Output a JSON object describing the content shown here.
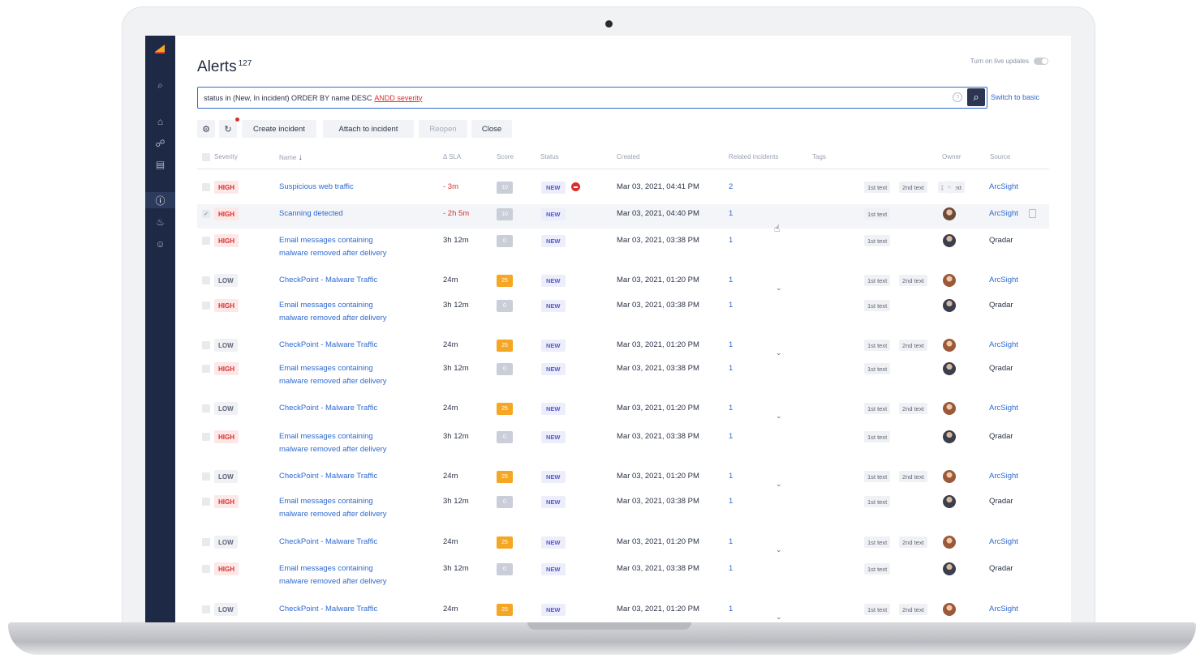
{
  "header": {
    "title": "Alerts",
    "count": "127",
    "live_label": "Turn on live updates"
  },
  "search": {
    "query_text": "status in (New, In incident) ORDER BY name DESC",
    "query_error": "ANDD severity",
    "help": "?",
    "switch_label": "Switch to basic"
  },
  "toolbar": {
    "create": "Create incident",
    "attach": "Attach to incident",
    "reopen": "Reopen",
    "close": "Close"
  },
  "columns": {
    "severity": "Severity",
    "name": "Name",
    "sla": "Δ SLA",
    "score": "Score",
    "status": "Status",
    "created": "Created",
    "related": "Related incidents",
    "tags": "Tags",
    "owner": "Owner",
    "source": "Source"
  },
  "sort_arrow": "↓",
  "colors": {
    "accent": "#2f6ad0",
    "danger": "#d92f2f",
    "sidebar": "#1e2a45",
    "score_high": "#f5a623",
    "score_low": "#c9ced8"
  },
  "icons": [
    "logo-icon",
    "search-icon",
    "home-icon",
    "users-icon",
    "document-icon",
    "alert-icon",
    "fire-icon",
    "chat-icon",
    "gear-icon",
    "refresh-icon",
    "stop-icon",
    "copy-icon",
    "chevron-down-icon",
    "hand-cursor-icon"
  ],
  "rows": [
    {
      "severity": "HIGH",
      "name_1": "Suspicious web traffic",
      "name_2": "",
      "sla": "- 3m",
      "score": "10",
      "status": "NEW",
      "created": "Mar 03, 2021, 04:41 PM",
      "related": "2",
      "tags": [
        "1st text",
        "2nd text",
        "3rd text"
      ],
      "source": "ArcSight"
    },
    {
      "severity": "HIGH",
      "name_1": "Scanning detected",
      "name_2": "",
      "sla": "- 2h 5m",
      "score": "10",
      "status": "NEW",
      "created": "Mar 03, 2021, 04:40 PM",
      "related": "1",
      "tags": [
        "1st text"
      ],
      "source": "ArcSight"
    },
    {
      "severity": "HIGH",
      "name_1": "Email messages containing",
      "name_2": "malware removed after delivery",
      "sla": "3h 12m",
      "score": "0",
      "status": "NEW",
      "created": "Mar 03, 2021, 03:38 PM",
      "related": "1",
      "tags": [
        "1st text"
      ],
      "source": "Qradar"
    },
    {
      "severity": "LOW",
      "name_1": "CheckPoint - Malware Traffic",
      "name_2": "",
      "sla": "24m",
      "score": "25",
      "status": "NEW",
      "created": "Mar 03, 2021, 01:20 PM",
      "related": "1",
      "tags": [
        "1st text",
        "2nd text"
      ],
      "source": "ArcSight"
    },
    {
      "severity": "HIGH",
      "name_1": "Email messages containing",
      "name_2": "malware removed after delivery",
      "sla": "3h 12m",
      "score": "0",
      "status": "NEW",
      "created": "Mar 03, 2021, 03:38 PM",
      "related": "1",
      "tags": [
        "1st text"
      ],
      "source": "Qradar"
    },
    {
      "severity": "LOW",
      "name_1": "CheckPoint - Malware Traffic",
      "name_2": "",
      "sla": "24m",
      "score": "25",
      "status": "NEW",
      "created": "Mar 03, 2021, 01:20 PM",
      "related": "1",
      "tags": [
        "1st text",
        "2nd text"
      ],
      "source": "ArcSight"
    },
    {
      "severity": "HIGH",
      "name_1": "Email messages containing",
      "name_2": "malware removed after delivery",
      "sla": "3h 12m",
      "score": "0",
      "status": "NEW",
      "created": "Mar 03, 2021, 03:38 PM",
      "related": "1",
      "tags": [
        "1st text"
      ],
      "source": "Qradar"
    },
    {
      "severity": "LOW",
      "name_1": "CheckPoint - Malware Traffic",
      "name_2": "",
      "sla": "24m",
      "score": "25",
      "status": "NEW",
      "created": "Mar 03, 2021, 01:20 PM",
      "related": "1",
      "tags": [
        "1st text",
        "2nd text"
      ],
      "source": "ArcSight"
    },
    {
      "severity": "HIGH",
      "name_1": "Email messages containing",
      "name_2": "malware removed after delivery",
      "sla": "3h 12m",
      "score": "0",
      "status": "NEW",
      "created": "Mar 03, 2021, 03:38 PM",
      "related": "1",
      "tags": [
        "1st text"
      ],
      "source": "Qradar"
    },
    {
      "severity": "LOW",
      "name_1": "CheckPoint - Malware Traffic",
      "name_2": "",
      "sla": "24m",
      "score": "25",
      "status": "NEW",
      "created": "Mar 03, 2021, 01:20 PM",
      "related": "1",
      "tags": [
        "1st text",
        "2nd text"
      ],
      "source": "ArcSight"
    },
    {
      "severity": "HIGH",
      "name_1": "Email messages containing",
      "name_2": "malware removed after delivery",
      "sla": "3h 12m",
      "score": "0",
      "status": "NEW",
      "created": "Mar 03, 2021, 03:38 PM",
      "related": "1",
      "tags": [
        "1st text"
      ],
      "source": "Qradar"
    },
    {
      "severity": "LOW",
      "name_1": "CheckPoint - Malware Traffic",
      "name_2": "",
      "sla": "24m",
      "score": "25",
      "status": "NEW",
      "created": "Mar 03, 2021, 01:20 PM",
      "related": "1",
      "tags": [
        "1st text",
        "2nd text"
      ],
      "source": "ArcSight"
    },
    {
      "severity": "HIGH",
      "name_1": "Email messages containing",
      "name_2": "malware removed after delivery",
      "sla": "3h 12m",
      "score": "0",
      "status": "NEW",
      "created": "Mar 03, 2021, 03:38 PM",
      "related": "1",
      "tags": [
        "1st text"
      ],
      "source": "Qradar"
    },
    {
      "severity": "LOW",
      "name_1": "CheckPoint - Malware Traffic",
      "name_2": "",
      "sla": "24m",
      "score": "25",
      "status": "NEW",
      "created": "Mar 03, 2021, 01:20 PM",
      "related": "1",
      "tags": [
        "1st text",
        "2nd text"
      ],
      "source": "ArcSight"
    }
  ]
}
